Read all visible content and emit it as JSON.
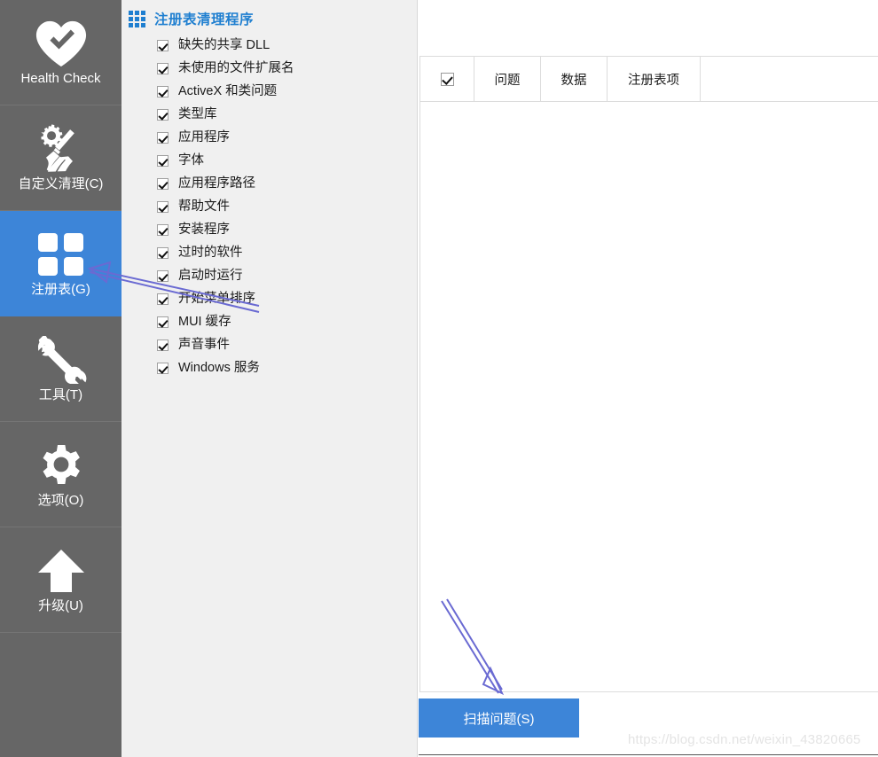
{
  "sidebar": {
    "items": [
      {
        "label": "Health Check",
        "icon": "heart-check-icon",
        "active": false
      },
      {
        "label": "自定义清理(C)",
        "icon": "broom-gear-icon",
        "active": false
      },
      {
        "label": "注册表(G)",
        "icon": "grid-squares-icon",
        "active": true
      },
      {
        "label": "工具(T)",
        "icon": "wrench-icon",
        "active": false
      },
      {
        "label": "选项(O)",
        "icon": "gear-icon",
        "active": false
      },
      {
        "label": "升级(U)",
        "icon": "arrow-up-icon",
        "active": false
      }
    ]
  },
  "list_panel": {
    "title": "注册表清理程序",
    "title_icon": "grid-squares-icon",
    "items": [
      {
        "label": "缺失的共享 DLL",
        "checked": true
      },
      {
        "label": "未使用的文件扩展名",
        "checked": true
      },
      {
        "label": "ActiveX 和类问题",
        "checked": true
      },
      {
        "label": "类型库",
        "checked": true
      },
      {
        "label": "应用程序",
        "checked": true
      },
      {
        "label": "字体",
        "checked": true
      },
      {
        "label": "应用程序路径",
        "checked": true
      },
      {
        "label": "帮助文件",
        "checked": true
      },
      {
        "label": "安装程序",
        "checked": true
      },
      {
        "label": "过时的软件",
        "checked": true
      },
      {
        "label": "启动时运行",
        "checked": true
      },
      {
        "label": "开始菜单排序",
        "checked": true
      },
      {
        "label": "MUI 缓存",
        "checked": true
      },
      {
        "label": "声音事件",
        "checked": true
      },
      {
        "label": "Windows 服务",
        "checked": true
      }
    ]
  },
  "results": {
    "select_all_checked": true,
    "columns": [
      "",
      "问题",
      "数据",
      "注册表项",
      ""
    ],
    "rows": []
  },
  "actions": {
    "scan_label": "扫描问题(S)"
  },
  "watermark": {
    "text": "https://blog.csdn.net/weixin_43820665"
  },
  "colors": {
    "accent_blue": "#3d85d8",
    "title_blue": "#1f7fd0",
    "sidebar_gray": "#666666",
    "panel_gray": "#f0f0f0",
    "annotation_purple": "#6a6ad2"
  }
}
